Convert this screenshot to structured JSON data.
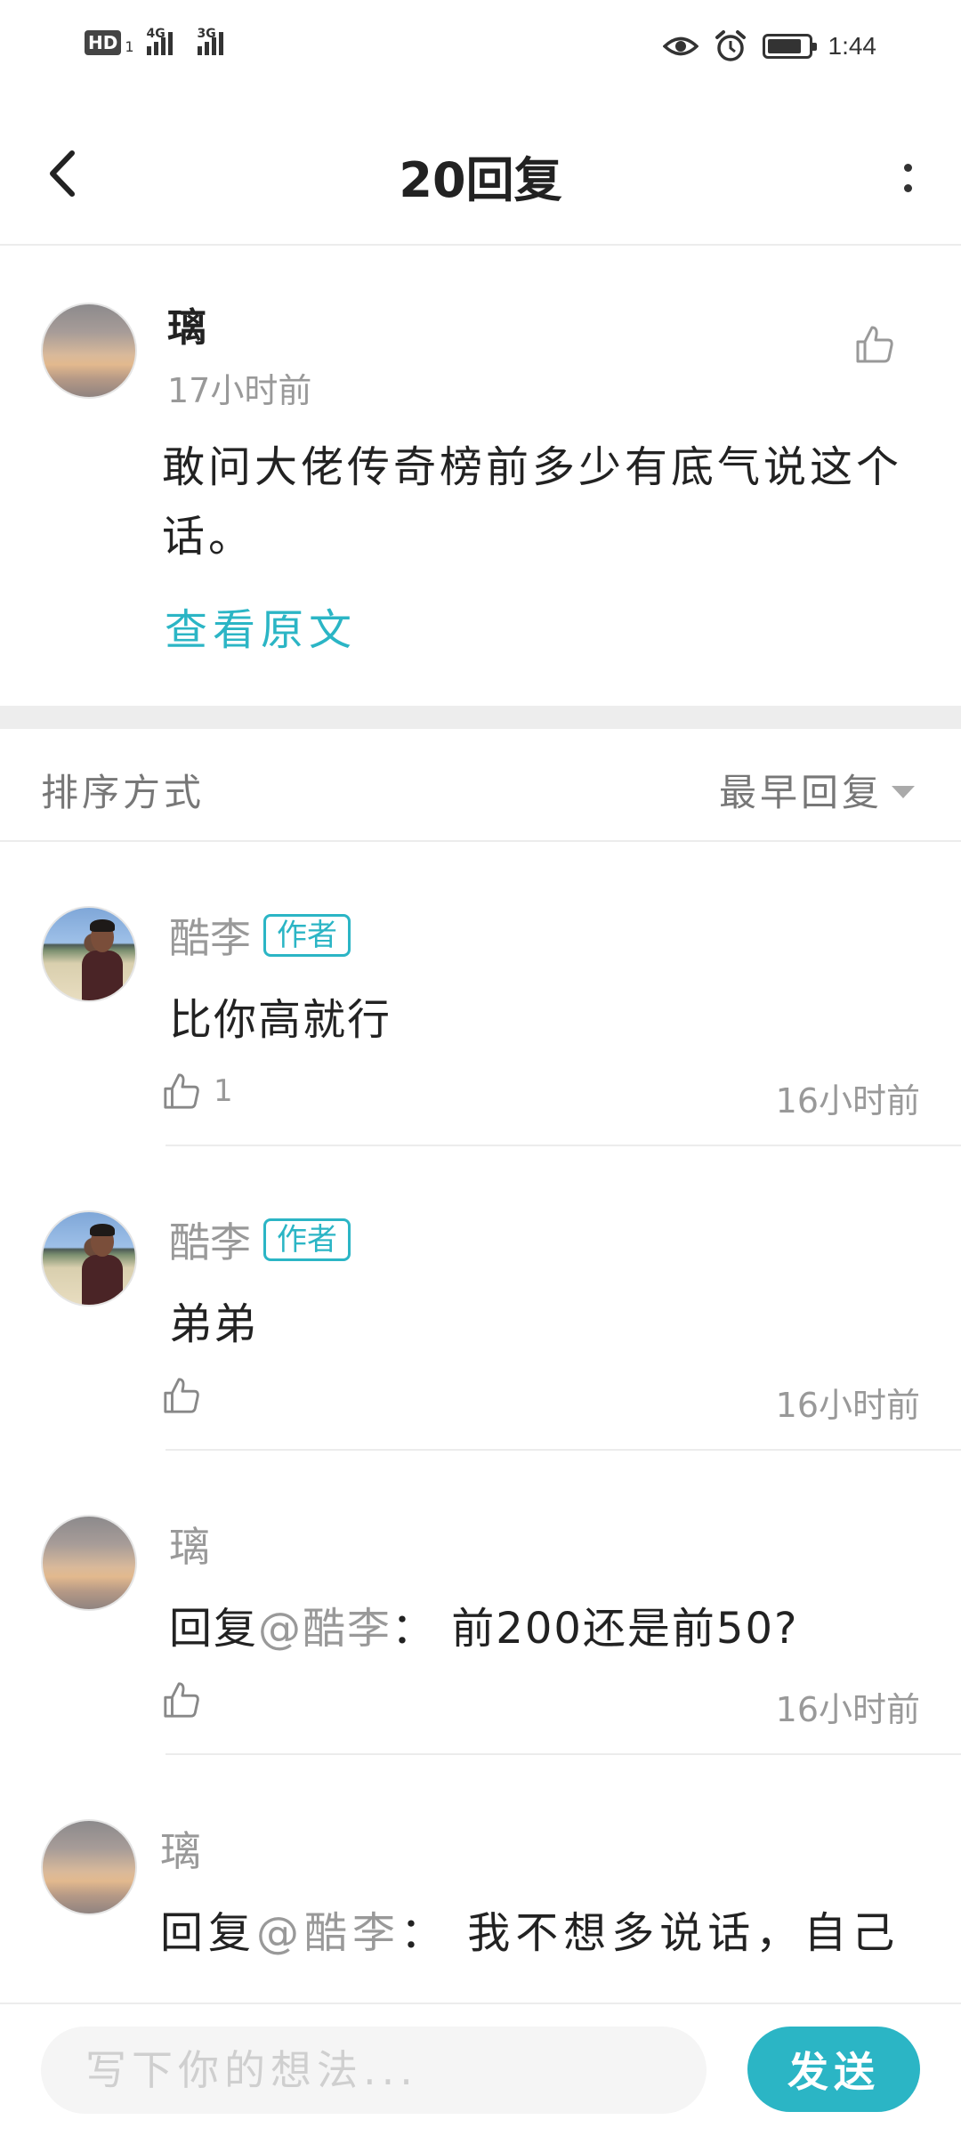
{
  "status_bar": {
    "hd_label": "HD",
    "sim1": "1",
    "net1": "4G",
    "net2": "3G",
    "time": "1:44"
  },
  "header": {
    "title": "20回复"
  },
  "original": {
    "author": "璃",
    "time": "17小时前",
    "text": "敢问大佬传奇榜前多少有底气说这个话。",
    "view_original": "查看原文"
  },
  "sort": {
    "label": "排序方式",
    "selected": "最早回复"
  },
  "replies": [
    {
      "author": "酷李",
      "badge": "作者",
      "text": "比你高就行",
      "like_count": "1",
      "time": "16小时前"
    },
    {
      "author": "酷李",
      "badge": "作者",
      "text": "弟弟",
      "like_count": "",
      "time": "16小时前"
    },
    {
      "author": "璃",
      "reply_prefix": "回复",
      "mention": "@酷李",
      "text": "： 前200还是前50?",
      "time": "16小时前"
    },
    {
      "author": "璃",
      "reply_prefix": "回复",
      "mention": "@酷李",
      "text": "： 我不想多说话，自己"
    }
  ],
  "composer": {
    "placeholder": "写下你的想法...",
    "send_label": "发送"
  },
  "colors": {
    "accent": "#2bb5c5",
    "muted_text": "#999999",
    "divider": "#ececec"
  }
}
